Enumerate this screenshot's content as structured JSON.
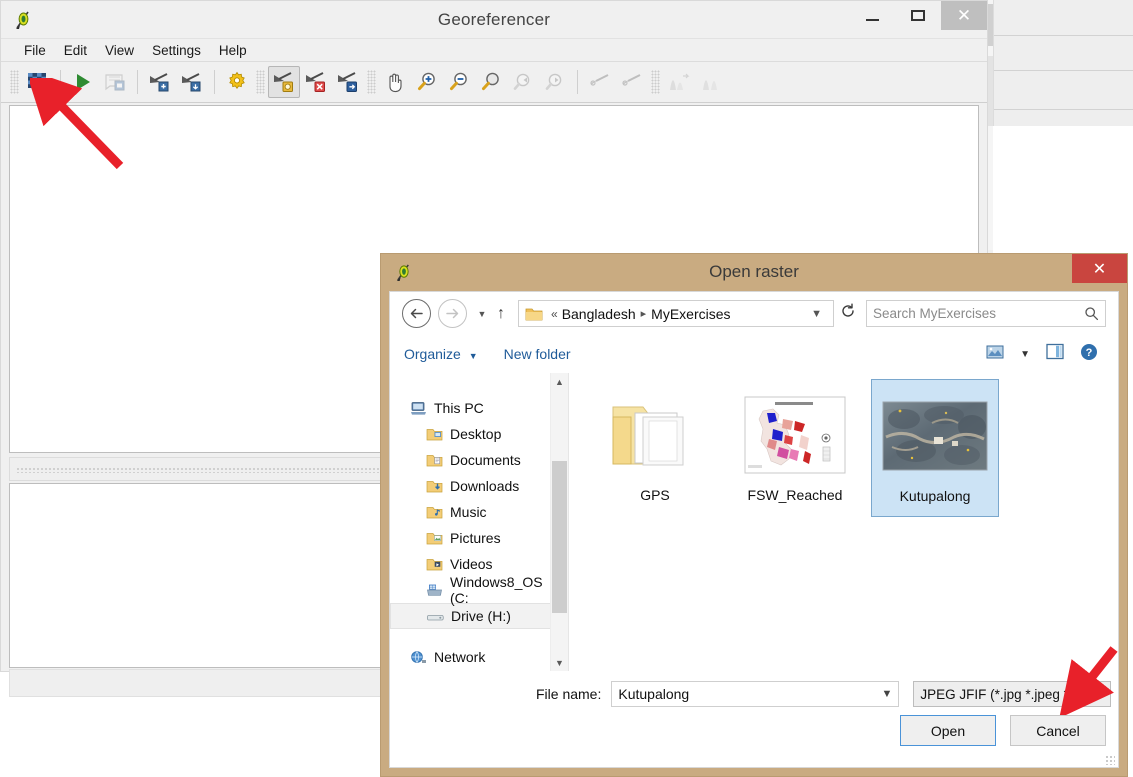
{
  "georeferencer": {
    "title": "Georeferencer",
    "logo_icon": "qgis-logo-icon",
    "window_controls": {
      "minimize": "minimize-icon",
      "maximize": "maximize-icon",
      "close": "✕"
    },
    "menus": [
      "File",
      "Edit",
      "View",
      "Settings",
      "Help"
    ],
    "toolbar": [
      {
        "name": "open-raster-button",
        "icon": "checkerboard-add-icon",
        "state": "enabled"
      },
      {
        "name": "start-georeferencing-button",
        "icon": "green-play-icon",
        "state": "enabled"
      },
      {
        "name": "generate-gdal-script-button",
        "icon": "script-save-icon",
        "state": "disabled"
      },
      {
        "name": "load-gcp-points-button",
        "icon": "gcp-load-icon",
        "state": "enabled"
      },
      {
        "name": "save-gcp-points-button",
        "icon": "gcp-save-icon",
        "state": "enabled"
      },
      {
        "name": "transformation-settings-button",
        "icon": "yellow-gear-icon",
        "state": "enabled"
      },
      {
        "name": "add-point-button",
        "icon": "gcp-add-point-icon",
        "state": "checked"
      },
      {
        "name": "delete-point-button",
        "icon": "gcp-delete-point-icon",
        "state": "enabled"
      },
      {
        "name": "move-gcp-point-button",
        "icon": "gcp-move-point-icon",
        "state": "enabled"
      },
      {
        "name": "pan-button",
        "icon": "hand-pan-icon",
        "state": "enabled"
      },
      {
        "name": "zoom-in-button",
        "icon": "zoom-in-icon",
        "state": "enabled"
      },
      {
        "name": "zoom-out-button",
        "icon": "zoom-out-icon",
        "state": "enabled"
      },
      {
        "name": "zoom-to-layer-button",
        "icon": "zoom-layer-icon",
        "state": "enabled"
      },
      {
        "name": "zoom-last-button",
        "icon": "zoom-last-icon",
        "state": "disabled"
      },
      {
        "name": "zoom-next-button",
        "icon": "zoom-next-icon",
        "state": "disabled"
      },
      {
        "name": "link-georeferencer-to-qgis-button",
        "icon": "link-chain-icon",
        "state": "disabled"
      },
      {
        "name": "link-qgis-to-georeferencer-button",
        "icon": "link-chain-2-icon",
        "state": "disabled"
      },
      {
        "name": "full-histogram-stretch-button",
        "icon": "histogram-stretch-icon",
        "state": "disabled"
      },
      {
        "name": "local-histogram-stretch-button",
        "icon": "histogram-icon",
        "state": "disabled"
      }
    ]
  },
  "dialog": {
    "title": "Open raster",
    "logo_icon": "qgis-logo-icon",
    "close_label": "✕",
    "nav": {
      "back_icon": "back-arrow-icon",
      "forward_icon": "forward-arrow-icon",
      "recent_icon": "chevron-down-icon",
      "up_icon": "up-arrow-icon"
    },
    "address": {
      "folder_icon": "folder-icon",
      "overflow": "«",
      "crumbs": [
        "Bangladesh",
        "MyExercises"
      ],
      "separator": "▸",
      "dropdown_icon": "chevron-down-icon",
      "refresh_icon": "refresh-icon"
    },
    "search": {
      "placeholder": "Search MyExercises",
      "icon": "search-icon"
    },
    "commandbar": {
      "organize": "Organize",
      "new_folder": "New folder",
      "view_icon": "change-view-icon",
      "view_caret": "chevron-down-icon",
      "preview_pane_icon": "preview-pane-icon",
      "help_icon": "help-icon"
    },
    "tree": {
      "scroll_up_icon": "chevron-up-icon",
      "scroll_down_icon": "chevron-down-icon",
      "items": [
        {
          "label": "This PC",
          "icon": "this-pc-icon",
          "level": 0,
          "selected": false
        },
        {
          "label": "Desktop",
          "icon": "desktop-folder-icon",
          "level": 1,
          "selected": false
        },
        {
          "label": "Documents",
          "icon": "documents-folder-icon",
          "level": 1,
          "selected": false
        },
        {
          "label": "Downloads",
          "icon": "downloads-folder-icon",
          "level": 1,
          "selected": false
        },
        {
          "label": "Music",
          "icon": "music-folder-icon",
          "level": 1,
          "selected": false
        },
        {
          "label": "Pictures",
          "icon": "pictures-folder-icon",
          "level": 1,
          "selected": false
        },
        {
          "label": "Videos",
          "icon": "videos-folder-icon",
          "level": 1,
          "selected": false
        },
        {
          "label": "Windows8_OS (C:",
          "icon": "hard-drive-icon",
          "level": 1,
          "selected": false
        },
        {
          "label": "Drive (H:)",
          "icon": "removable-drive-icon",
          "level": 1,
          "selected": true
        },
        {
          "label": "Network",
          "icon": "network-icon",
          "level": 0,
          "selected": false
        }
      ]
    },
    "files": [
      {
        "label": "GPS",
        "type": "folder",
        "selected": false
      },
      {
        "label": "FSW_Reached",
        "type": "map-image",
        "selected": false
      },
      {
        "label": "Kutupalong",
        "type": "satellite-image",
        "selected": true
      }
    ],
    "filename": {
      "label": "File name:",
      "value": "Kutupalong",
      "dropdown_icon": "chevron-down-icon"
    },
    "filetype": {
      "value": "JPEG JFIF (*.jpg *.jpeg *.JPG ",
      "trailing": "’",
      "dropdown_icon": "chevron-down-icon"
    },
    "buttons": {
      "open": "Open",
      "cancel": "Cancel"
    }
  },
  "annotations": {
    "arrow_color": "#e8212a",
    "arrows": [
      {
        "name": "arrow-to-open-raster-button",
        "points_to": "open-raster-button"
      },
      {
        "name": "arrow-to-filetype-dropdown",
        "points_to": "filetype-dropdown"
      }
    ]
  },
  "colors": {
    "dialog_frame": "#c9ab81",
    "close_red": "#c9453f",
    "selection_blue": "#cce3f5",
    "link_blue": "#1f5b99",
    "window_gray": "#f0f0f0"
  }
}
